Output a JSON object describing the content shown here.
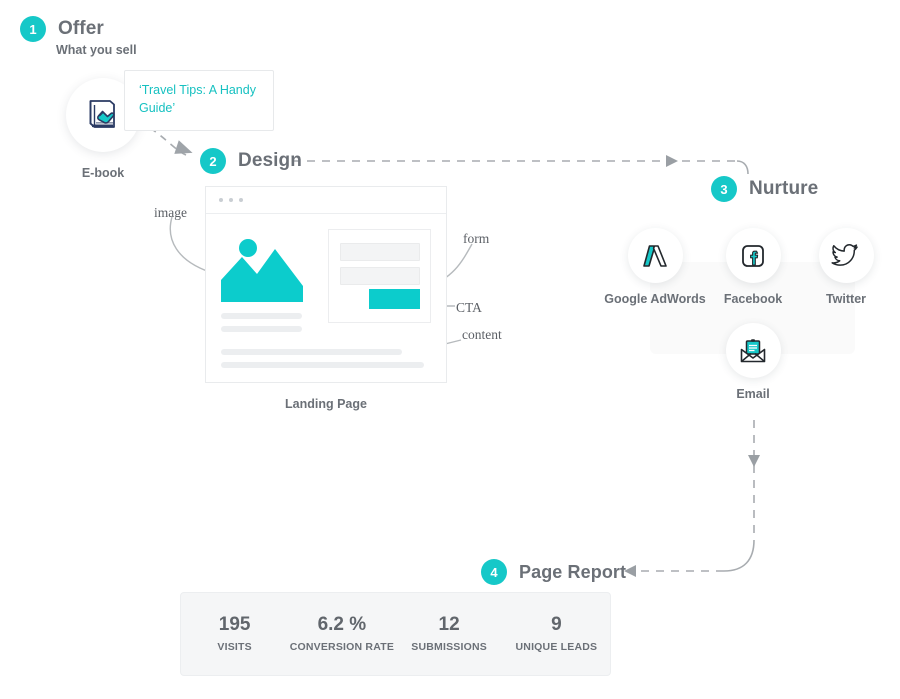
{
  "accent_color": "#16c8c8",
  "text_color": "#6b7077",
  "steps": {
    "offer": {
      "number": "1",
      "title": "Offer",
      "subtitle": "What you sell",
      "tooltip": "‘Travel Tips: A Handy Guide’",
      "asset_caption": "E-book",
      "asset_icon": "ebook-icon"
    },
    "design": {
      "number": "2",
      "title": "Design",
      "caption": "Landing Page",
      "annotations": [
        {
          "id": "image",
          "label": "image"
        },
        {
          "id": "form",
          "label": "form"
        },
        {
          "id": "cta",
          "label": "CTA"
        },
        {
          "id": "content",
          "label": "content"
        }
      ]
    },
    "nurture": {
      "number": "3",
      "title": "Nurture",
      "channels": [
        {
          "name": "Google AdWords",
          "icon": "google-adwords-icon"
        },
        {
          "name": "Facebook",
          "icon": "facebook-icon"
        },
        {
          "name": "Twitter",
          "icon": "twitter-icon"
        },
        {
          "name": "Email",
          "icon": "email-icon"
        }
      ]
    },
    "report": {
      "number": "4",
      "title": "Page Report",
      "stats": [
        {
          "value": "195",
          "label": "VISITS"
        },
        {
          "value": "6.2 %",
          "label": "CONVERSION RATE"
        },
        {
          "value": "12",
          "label": "SUBMISSIONS"
        },
        {
          "value": "9",
          "label": "UNIQUE LEADS"
        }
      ]
    }
  }
}
